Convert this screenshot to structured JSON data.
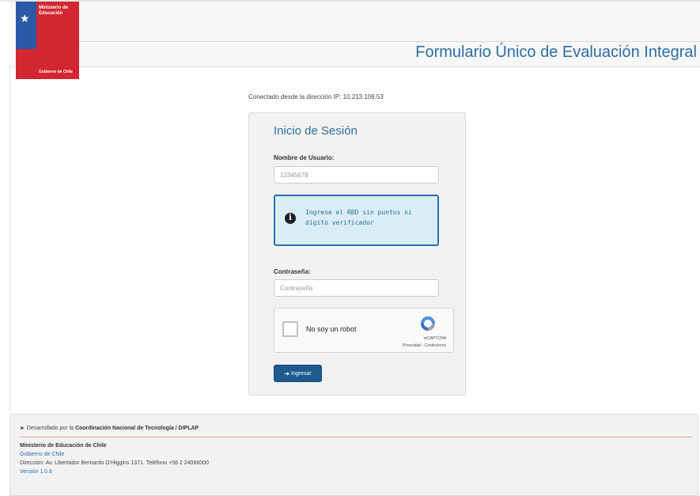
{
  "header": {
    "logo_ministry": "Ministerio de Educación",
    "logo_government": "Gobierno de Chile",
    "app_title": "Formulario Único de Evaluación Integral"
  },
  "connection": {
    "ip_text": "Conectado desde la dirección IP: 10.213.106.53"
  },
  "login": {
    "title": "Inicio de Sesión",
    "username_label": "Nombre de Usuario:",
    "username_value": "12345678",
    "info_message": "Ingrese el RBD sin puntos ni dígito verificador",
    "password_label": "Contraseña:",
    "password_placeholder": "Contraseña",
    "captcha_label": "No soy un robot",
    "captcha_brand": "reCAPTCHA",
    "captcha_links": "Privacidad - Condiciones",
    "submit_label": "Ingresar"
  },
  "footer": {
    "developed_prefix": "Desarrollado por la",
    "developed_by": "Coordinación Nacional de Tecnología / DIPLAP",
    "ministry": "Ministerio de Educación de Chile",
    "government_link": "Gobierno de Chile",
    "address": "Dirección: Av. Libertador Bernardo O'Higgins 1371. Teléfono +56 2 24066000",
    "version": "Versión 1.0.8"
  },
  "icons": {
    "info": "info-circle-icon",
    "submit": "sign-in-icon",
    "captcha": "recaptcha-logo-icon",
    "footer_toggle": "caret-right-icon"
  },
  "colors": {
    "brand_blue": "#2e6da4",
    "button_blue": "#1f5a8f",
    "info_bg": "#d9edf7",
    "flag_red": "#d22630",
    "flag_blue": "#2b59a5"
  }
}
